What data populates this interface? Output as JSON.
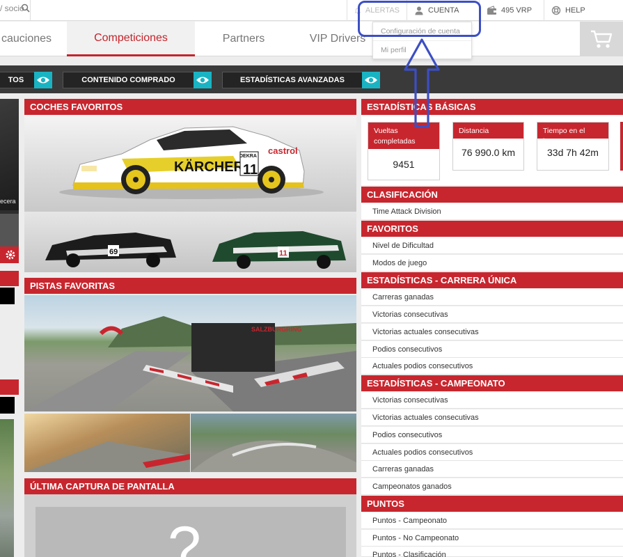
{
  "topbar": {
    "search_text": "/ socio",
    "alerts_label": "ALERTAS",
    "account_label": "CUENTA",
    "vrp_label": "495 VRP",
    "help_label": "HELP"
  },
  "account_menu": {
    "items": [
      {
        "label": "Configuración de cuenta"
      },
      {
        "label": "Mi perfil"
      }
    ]
  },
  "nav": {
    "tabs": [
      {
        "label": "cauciones"
      },
      {
        "label": "Competiciones"
      },
      {
        "label": "Partners"
      },
      {
        "label": "VIP Drivers"
      }
    ]
  },
  "filters": {
    "buttons": [
      {
        "label": "TOS"
      },
      {
        "label": "CONTENIDO COMPRADO"
      },
      {
        "label": "ESTADÍSTICAS AVANZADAS"
      }
    ]
  },
  "left": {
    "fragment_text": "ecera"
  },
  "middle": {
    "fav_cars_title": "COCHES FAVORITOS",
    "fav_tracks_title": "PISTAS FAVORITAS",
    "last_screenshot_title": "ÚLTIMA CAPTURA DE PANTALLA",
    "car_number": "11",
    "car_sponsor": "KÄRCHER",
    "car_sponsor2": "castrol",
    "car_sponsor3": "DEKRA",
    "car2_number": "69",
    "car3_number": "11",
    "track_sign": "SALZBURGRING",
    "placeholder_glyph": "?"
  },
  "right": {
    "basic_stats_title": "ESTADÍSTICAS BÁSICAS",
    "stat_cards": [
      {
        "label": "Vueltas completadas",
        "value": "9451"
      },
      {
        "label": "Distancia",
        "value": "76 990.0 km"
      },
      {
        "label": "Tiempo en el juego",
        "value": "33d 7h 42m"
      }
    ],
    "classification_title": "CLASIFICACIÓN",
    "classification_items": [
      "Time Attack Division"
    ],
    "favorites_title": "FAVORITOS",
    "favorites_items": [
      "Nivel de Dificultad",
      "Modos de juego"
    ],
    "single_race_title": "ESTADÍSTICAS - CARRERA ÚNICA",
    "single_race_items": [
      "Carreras ganadas",
      "Victorias consecutivas",
      "Victorias actuales consecutivas",
      "Podios consecutivos",
      "Actuales podios consecutivos"
    ],
    "championship_title": "ESTADÍSTICAS - CAMPEONATO",
    "championship_items": [
      "Victorias consecutivas",
      "Victorias actuales consecutivas",
      "Podios consecutivos",
      "Actuales podios consecutivos",
      "Carreras ganadas",
      "Campeonatos ganados"
    ],
    "points_title": "PUNTOS",
    "points_items": [
      "Puntos - Campeonato",
      "Puntos - No Campeonato",
      "Puntos - Clasificación"
    ]
  },
  "colors": {
    "brand_red": "#c8262e",
    "annotation_blue": "#3c4fc4",
    "eye_teal": "#19b4c3"
  }
}
